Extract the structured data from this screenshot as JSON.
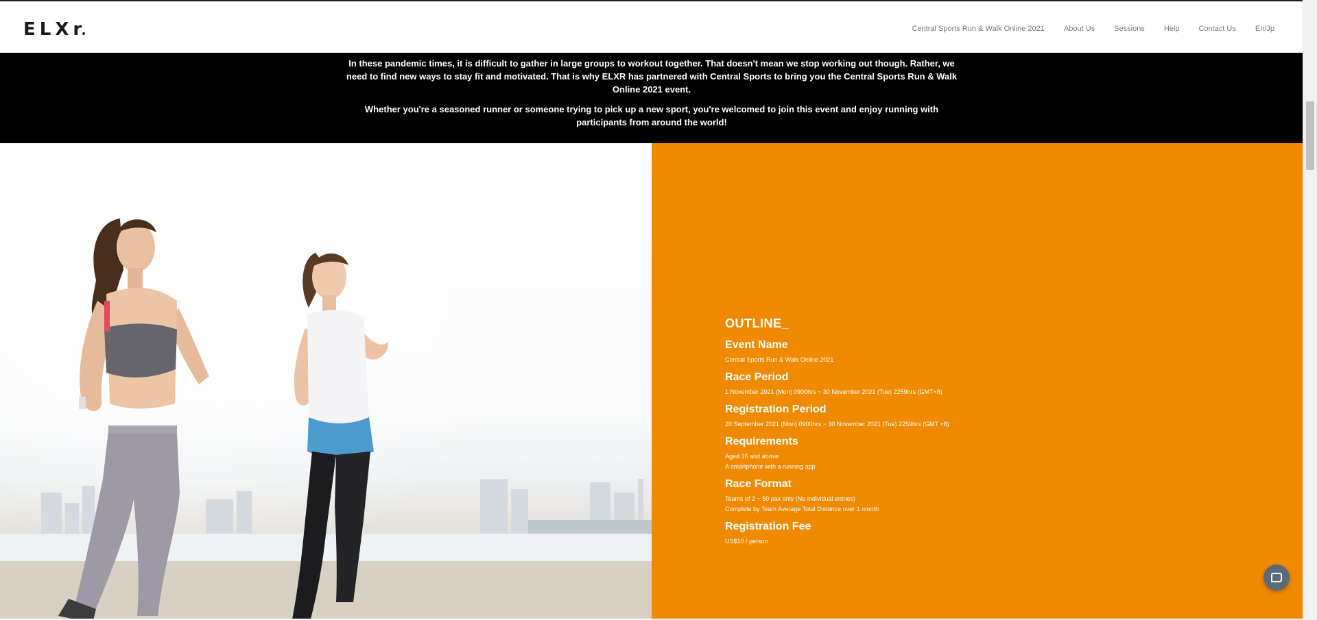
{
  "header": {
    "logo_text": "ELXr",
    "nav": [
      {
        "label": "Central Sports Run & Walk Online 2021"
      },
      {
        "label": "About Us"
      },
      {
        "label": "Sessions"
      },
      {
        "label": "Help"
      },
      {
        "label": "Contact Us"
      },
      {
        "label": "En/Jp"
      }
    ]
  },
  "intro": {
    "paragraph1": "In these pandemic times, it is difficult to gather in large groups to workout together. That doesn't mean we stop working out though. Rather, we need to find new ways to stay fit and motivated. That is why ELXR has partnered with Central Sports to bring you the Central Sports Run & Walk Online 2021 event.",
    "paragraph2": "Whether you're a seasoned runner or someone trying to pick up a new sport, you're welcomed to join this event and enjoy running with participants from around the world!"
  },
  "outline": {
    "title": "OUTLINE_",
    "fields": [
      {
        "label": "Event Name",
        "lines": [
          "Central Sports Run & Walk Online 2021"
        ]
      },
      {
        "label": "Race Period",
        "lines": [
          "1 November 2021 (Mon) 0900hrs ~ 30 November 2021 (Tue) 2259hrs (GMT+8)"
        ]
      },
      {
        "label": "Registration Period",
        "lines": [
          "20 September 2021 (Mon) 0900hrs ~ 30 November 2021 (Tue) 2259hrs (GMT +8)"
        ]
      },
      {
        "label": "Requirements",
        "lines": [
          "Aged 16 and above",
          "A smartphone with a running app"
        ]
      },
      {
        "label": "Race Format",
        "lines": [
          "Teams of 2 ~ 50 pax only (No individual entries)",
          "Complete by Team Average Total Distance over 1 month"
        ]
      },
      {
        "label": "Registration Fee",
        "lines": [
          "US$10 / person"
        ]
      }
    ]
  },
  "colors": {
    "accent": "#ef8a00",
    "intro_bg": "#000000"
  },
  "icons": {
    "chat": "chat-bubble-icon"
  }
}
